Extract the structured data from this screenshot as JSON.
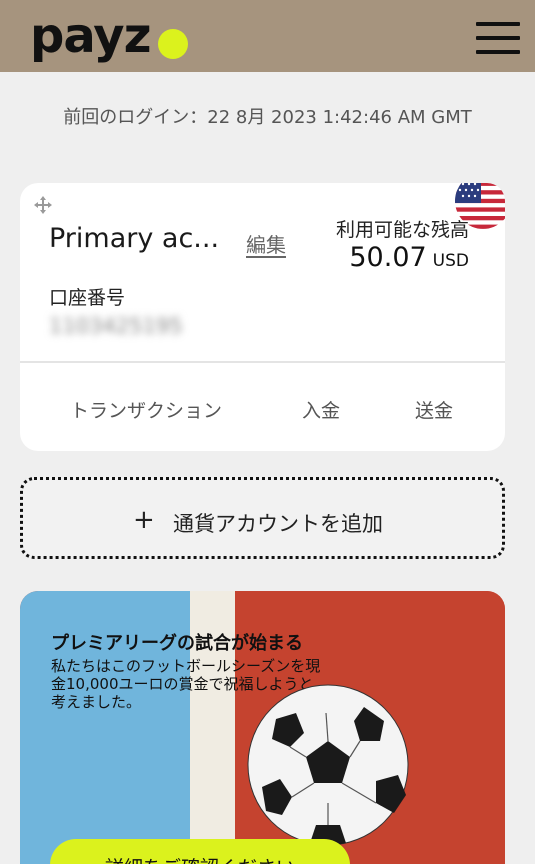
{
  "header": {
    "logo_text": "payz",
    "menu_icon": "hamburger-menu-icon",
    "logo_dot_color": "#dbf21d",
    "bg_color": "#a6947e"
  },
  "last_login": "前回のログイン：22 8月 2023 1:42:46 AM GMT",
  "account": {
    "name": "Primary ac...",
    "edit_label": "編集",
    "balance_label": "利用可能な残高",
    "balance_amount": "50.07",
    "currency": "USD",
    "account_number_label": "口座番号",
    "account_number": "1103425195",
    "flag_icon": "us-flag-icon",
    "move_icon": "move-handle-icon",
    "actions": [
      "トランザクション",
      "入金",
      "送金"
    ]
  },
  "add_currency": {
    "icon": "plus-icon",
    "label": "通貨アカウントを追加"
  },
  "promo": {
    "title": "プレミアリーグの試合が始まる",
    "body": "私たちはこのフットボールシーズンを現金10,000ユーロの賞金で祝福しようと考えました。",
    "button_label": "詳細をご確認ください",
    "image": "soccer-ball-image"
  }
}
